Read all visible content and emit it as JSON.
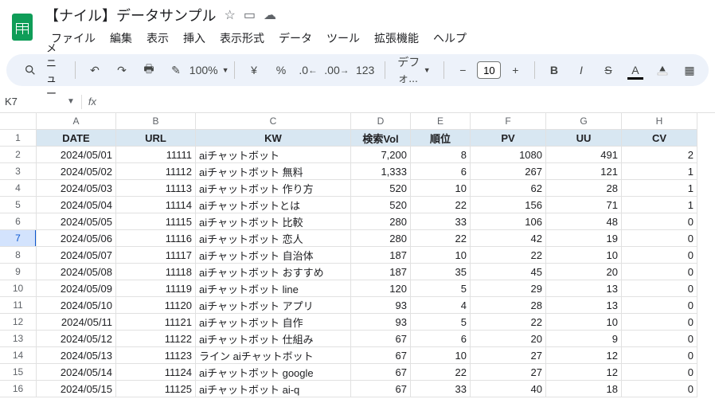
{
  "doc": {
    "title": "【ナイル】データサンプル"
  },
  "menus": {
    "file": "ファイル",
    "edit": "編集",
    "view": "表示",
    "insert": "挿入",
    "format": "表示形式",
    "data": "データ",
    "tools": "ツール",
    "extensions": "拡張機能",
    "help": "ヘルプ"
  },
  "toolbar": {
    "search": "メニュー",
    "zoom": "100%",
    "font": "デフォ...",
    "fontsize": "10",
    "currency": "¥",
    "percent": "%",
    "dec_dec": ".0",
    "dec_inc": ".00",
    "numfmt": "123"
  },
  "namebox": {
    "cell": "K7"
  },
  "columns": [
    "A",
    "B",
    "C",
    "D",
    "E",
    "F",
    "G",
    "H"
  ],
  "headers": {
    "A": "DATE",
    "B": "URL",
    "C": "KW",
    "D": "検索Vol",
    "E": "順位",
    "F": "PV",
    "G": "UU",
    "H": "CV"
  },
  "selected_row": 7,
  "rows": [
    {
      "n": 2,
      "A": "2024/05/01",
      "B": "11111",
      "C": "aiチャットボット",
      "D": "7,200",
      "E": "8",
      "F": "1080",
      "G": "491",
      "H": "2"
    },
    {
      "n": 3,
      "A": "2024/05/02",
      "B": "11112",
      "C": "aiチャットボット 無料",
      "D": "1,333",
      "E": "6",
      "F": "267",
      "G": "121",
      "H": "1"
    },
    {
      "n": 4,
      "A": "2024/05/03",
      "B": "11113",
      "C": "aiチャットボット 作り方",
      "D": "520",
      "E": "10",
      "F": "62",
      "G": "28",
      "H": "1"
    },
    {
      "n": 5,
      "A": "2024/05/04",
      "B": "11114",
      "C": "aiチャットボットとは",
      "D": "520",
      "E": "22",
      "F": "156",
      "G": "71",
      "H": "1"
    },
    {
      "n": 6,
      "A": "2024/05/05",
      "B": "11115",
      "C": "aiチャットボット 比較",
      "D": "280",
      "E": "33",
      "F": "106",
      "G": "48",
      "H": "0"
    },
    {
      "n": 7,
      "A": "2024/05/06",
      "B": "11116",
      "C": "aiチャットボット 恋人",
      "D": "280",
      "E": "22",
      "F": "42",
      "G": "19",
      "H": "0"
    },
    {
      "n": 8,
      "A": "2024/05/07",
      "B": "11117",
      "C": "aiチャットボット 自治体",
      "D": "187",
      "E": "10",
      "F": "22",
      "G": "10",
      "H": "0"
    },
    {
      "n": 9,
      "A": "2024/05/08",
      "B": "11118",
      "C": "aiチャットボット おすすめ",
      "D": "187",
      "E": "35",
      "F": "45",
      "G": "20",
      "H": "0"
    },
    {
      "n": 10,
      "A": "2024/05/09",
      "B": "11119",
      "C": "aiチャットボット line",
      "D": "120",
      "E": "5",
      "F": "29",
      "G": "13",
      "H": "0"
    },
    {
      "n": 11,
      "A": "2024/05/10",
      "B": "11120",
      "C": "aiチャットボット アプリ",
      "D": "93",
      "E": "4",
      "F": "28",
      "G": "13",
      "H": "0"
    },
    {
      "n": 12,
      "A": "2024/05/11",
      "B": "11121",
      "C": "aiチャットボット 自作",
      "D": "93",
      "E": "5",
      "F": "22",
      "G": "10",
      "H": "0"
    },
    {
      "n": 13,
      "A": "2024/05/12",
      "B": "11122",
      "C": "aiチャットボット 仕組み",
      "D": "67",
      "E": "6",
      "F": "20",
      "G": "9",
      "H": "0"
    },
    {
      "n": 14,
      "A": "2024/05/13",
      "B": "11123",
      "C": "ライン aiチャットボット",
      "D": "67",
      "E": "10",
      "F": "27",
      "G": "12",
      "H": "0"
    },
    {
      "n": 15,
      "A": "2024/05/14",
      "B": "11124",
      "C": "aiチャットボット google",
      "D": "67",
      "E": "22",
      "F": "27",
      "G": "12",
      "H": "0"
    },
    {
      "n": 16,
      "A": "2024/05/15",
      "B": "11125",
      "C": "aiチャットボット ai-q",
      "D": "67",
      "E": "33",
      "F": "40",
      "G": "18",
      "H": "0"
    }
  ]
}
